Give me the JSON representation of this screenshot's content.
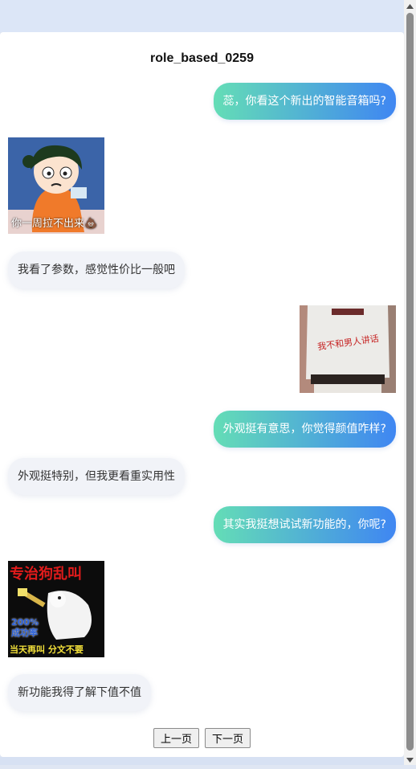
{
  "page": {
    "title": "role_based_0259"
  },
  "messages": [
    {
      "side": "right",
      "type": "text",
      "text": "蕊，你看这个新出的智能音箱吗?"
    },
    {
      "side": "left",
      "type": "image",
      "caption": "你一周拉不出来💩"
    },
    {
      "side": "left",
      "type": "text",
      "text": "我看了参数，感觉性价比一般吧"
    },
    {
      "side": "right",
      "type": "image",
      "caption": "我不和男人讲话"
    },
    {
      "side": "right",
      "type": "text",
      "text": "外观挺有意思，你觉得颜值咋样?"
    },
    {
      "side": "left",
      "type": "text",
      "text": "外观挺特别，但我更看重实用性"
    },
    {
      "side": "right",
      "type": "text",
      "text": "其实我挺想试试新功能的，你呢?"
    },
    {
      "side": "left",
      "type": "image",
      "caption_top": "专治狗乱叫",
      "caption_mid": "200%\n成功率",
      "caption_bottom": "当天再叫 分文不要"
    },
    {
      "side": "left",
      "type": "text",
      "text": "新功能我得了解下值不值"
    }
  ],
  "pagination": {
    "prev_label": "上一页",
    "next_label": "下一页"
  }
}
